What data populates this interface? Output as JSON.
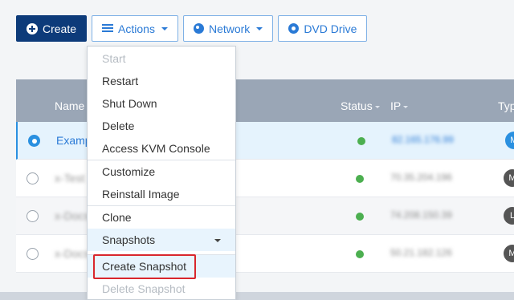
{
  "toolbar": {
    "create_label": "Create",
    "actions_label": "Actions",
    "network_label": "Network",
    "dvd_label": "DVD Drive"
  },
  "table": {
    "headers": {
      "name": "Name",
      "status": "Status",
      "ip": "IP",
      "type": "Typ"
    },
    "rows": [
      {
        "name": "Examp",
        "ip": "82.165.176.99",
        "type": "M",
        "status": "running",
        "selected": true
      },
      {
        "name": "x-Test",
        "ip": "70.35.204.196",
        "type": "M",
        "status": "running",
        "selected": false
      },
      {
        "name": "x-Docs",
        "ip": "74.208.150.39",
        "type": "L",
        "status": "running",
        "selected": false
      },
      {
        "name": "x-Docs",
        "ip": "50.21.182.126",
        "type": "M",
        "status": "running",
        "selected": false
      }
    ]
  },
  "menu": {
    "start": "Start",
    "restart": "Restart",
    "shutdown": "Shut Down",
    "delete": "Delete",
    "kvm": "Access KVM Console",
    "customize": "Customize",
    "reinstall": "Reinstall Image",
    "clone": "Clone",
    "snapshots": "Snapshots",
    "create_snapshot": "Create Snapshot",
    "delete_snapshot": "Delete Snapshot"
  },
  "colors": {
    "primary": "#0d3b7a",
    "accent": "#2a7ad6",
    "status_ok": "#4caf50",
    "highlight_border": "#d9262c"
  }
}
